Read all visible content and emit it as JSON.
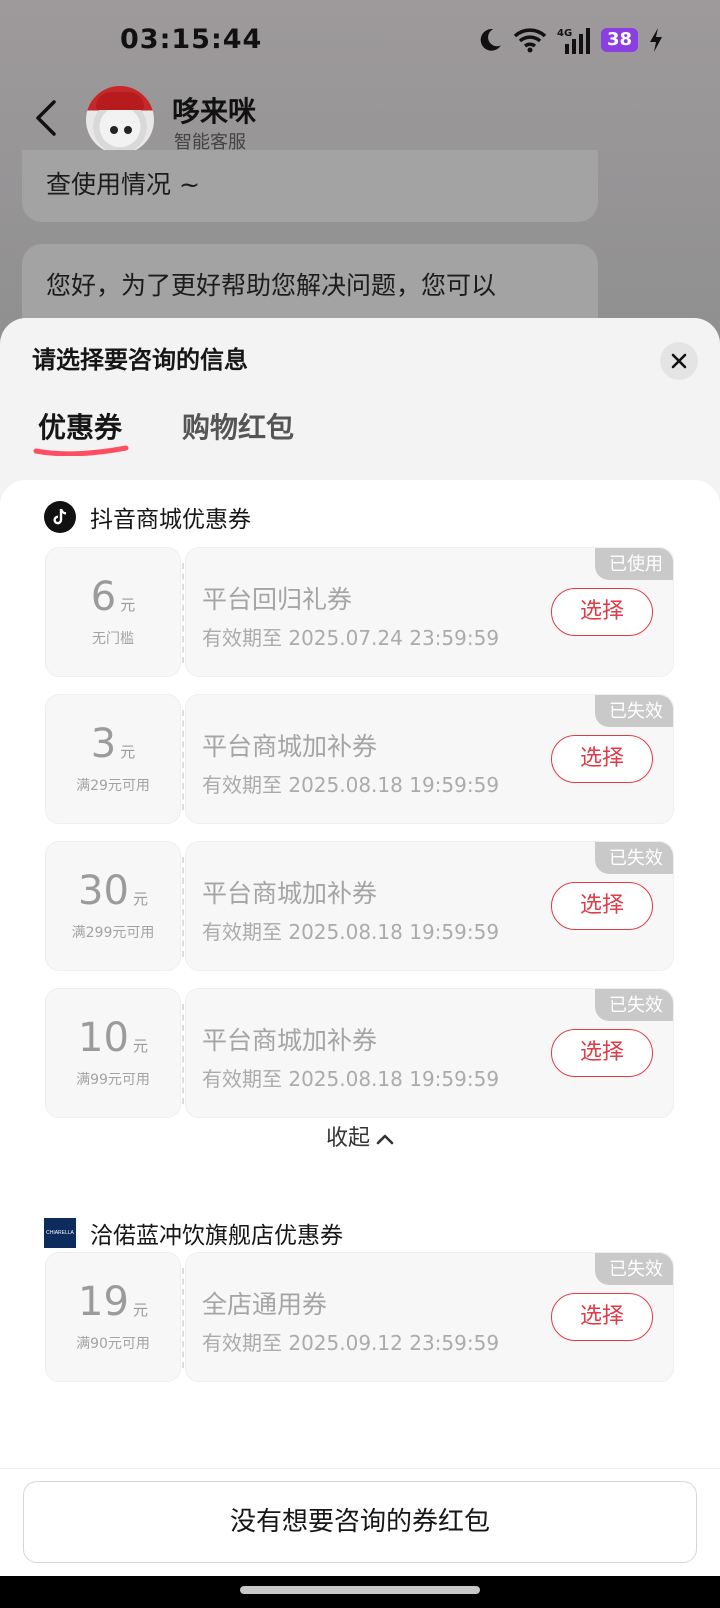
{
  "status_bar": {
    "time": "03:15:44",
    "battery": "38",
    "network": "4G"
  },
  "header": {
    "bot_name": "哆来咪",
    "bot_subtitle": "智能客服"
  },
  "chat": {
    "bubble1": "查使用情况 ~",
    "bubble2": "您好，为了更好帮助您解决问题，您可以"
  },
  "sheet": {
    "title": "请选择要咨询的信息",
    "tabs": [
      {
        "label": "优惠券",
        "active": true
      },
      {
        "label": "购物红包",
        "active": false
      }
    ],
    "collapse_label": "收起",
    "footer_button": "没有想要咨询的券红包"
  },
  "sections": [
    {
      "name": "抖音商城优惠券",
      "logo": "tiktok-logo",
      "coupons": [
        {
          "amount": "6",
          "unit": "元",
          "condition": "无门槛",
          "title": "平台回归礼券",
          "validity": "有效期至 2025.07.24 23:59:59",
          "status": "已使用",
          "action": "选择"
        },
        {
          "amount": "3",
          "unit": "元",
          "condition": "满29元可用",
          "title": "平台商城加补券",
          "validity": "有效期至 2025.08.18 19:59:59",
          "status": "已失效",
          "action": "选择"
        },
        {
          "amount": "30",
          "unit": "元",
          "condition": "满299元可用",
          "title": "平台商城加补券",
          "validity": "有效期至 2025.08.18 19:59:59",
          "status": "已失效",
          "action": "选择"
        },
        {
          "amount": "10",
          "unit": "元",
          "condition": "满99元可用",
          "title": "平台商城加补券",
          "validity": "有效期至 2025.08.18 19:59:59",
          "status": "已失效",
          "action": "选择"
        }
      ]
    },
    {
      "name": "洽偌蓝冲饮旗舰店优惠券",
      "logo": "chiarella-logo",
      "logo_text": "CHIARELLA",
      "coupons": [
        {
          "amount": "19",
          "unit": "元",
          "condition": "满90元可用",
          "title": "全店通用券",
          "validity": "有效期至 2025.09.12 23:59:59",
          "status": "已失效",
          "action": "选择"
        }
      ]
    }
  ],
  "colors": {
    "accent": "#e23a46",
    "sheet_bg": "#f3f3f3",
    "badge_bg": "#c9c9c9",
    "battery": "#8b3fe0"
  }
}
